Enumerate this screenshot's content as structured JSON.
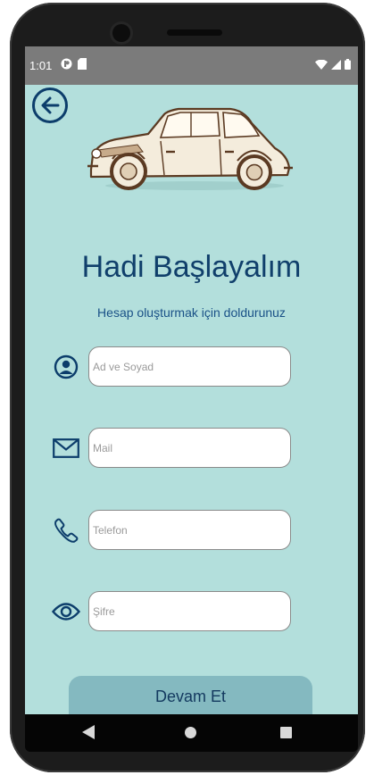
{
  "status_bar": {
    "time": "1:01"
  },
  "header": {
    "title": "Hadi Başlayalım",
    "subtitle": "Hesap oluşturmak için doldurunuz"
  },
  "form": {
    "fields": [
      {
        "icon": "person-icon",
        "placeholder": "Ad ve Soyad",
        "value": ""
      },
      {
        "icon": "mail-icon",
        "placeholder": "Mail",
        "value": ""
      },
      {
        "icon": "phone-icon",
        "placeholder": "Telefon",
        "value": ""
      },
      {
        "icon": "eye-icon",
        "placeholder": "Şifre",
        "value": ""
      }
    ],
    "submit_label": "Devam Et"
  },
  "colors": {
    "background": "#b3dfdc",
    "primary_text": "#103f6b",
    "button": "#84b9c0",
    "status_bar": "#7b7b7b"
  }
}
